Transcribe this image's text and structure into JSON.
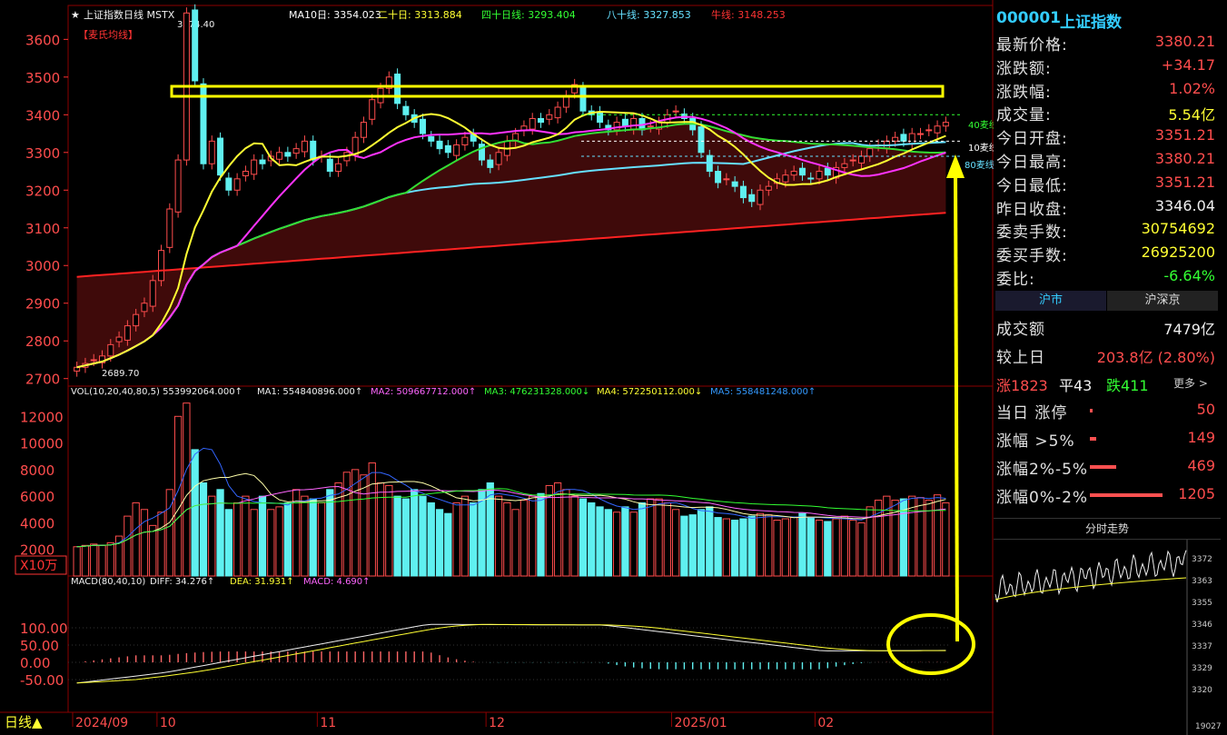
{
  "header": {
    "star": "★",
    "title": "上证指数日线 MSTX",
    "ma10": "MA10日: 3354.023",
    "ma20": "二十日: 3313.884",
    "ma40": "四十日线: 3293.404",
    "ma80": "八十线: 3327.853",
    "bull": "牛线: 3148.253",
    "tag": "【麦氏均线】",
    "high_label": "3674.40",
    "low_label": "2689.70"
  },
  "vol_header": {
    "title": "VOL(10,20,40,80,5) 553992064.000↑",
    "ma1": "MA1: 554840896.000↑",
    "ma2": "MA2: 509667712.000↑",
    "ma3": "MA3: 476231328.000↓",
    "ma4": "MA4: 572250112.000↓",
    "ma5": "MA5: 558481248.000↑",
    "unit": "X10万"
  },
  "macd_header": {
    "title": "MACD(80,40,10)",
    "diff": "DIFF: 34.276↑",
    "dea": "DEA: 31.931↑",
    "macd": "MACD: 4.690↑"
  },
  "line_labels": {
    "l40": "40麦线",
    "l10": "10麦线",
    "l80": "80麦线"
  },
  "bottom": {
    "period": "日线▲",
    "dates": [
      "2024/09",
      "10",
      "11",
      "12",
      "2025/01",
      "02"
    ]
  },
  "price_axis": [
    "3600",
    "3500",
    "3400",
    "3300",
    "3200",
    "3100",
    "3000",
    "2900",
    "2800",
    "2700"
  ],
  "vol_axis": [
    "12000",
    "10000",
    "8000",
    "6000",
    "4000",
    "2000"
  ],
  "macd_axis": [
    "100.00",
    "50.00",
    "0.00",
    "-50.00"
  ],
  "quote": {
    "code": "000001",
    "name": "上证指数",
    "rows": [
      {
        "label": "最新价格:",
        "value": "3380.21",
        "color": "red"
      },
      {
        "label": "涨跌额:",
        "value": "+34.17",
        "color": "red"
      },
      {
        "label": "涨跌幅:",
        "value": "1.02%",
        "color": "red"
      },
      {
        "label": "成交量:",
        "value": "5.54亿",
        "color": "yel"
      },
      {
        "label": "今日开盘:",
        "value": "3351.21",
        "color": "red"
      },
      {
        "label": "今日最高:",
        "value": "3380.21",
        "color": "red"
      },
      {
        "label": "今日最低:",
        "value": "3351.21",
        "color": "red"
      },
      {
        "label": "昨日收盘:",
        "value": "3346.04",
        "color": "wht"
      },
      {
        "label": "委卖手数:",
        "value": "30754692",
        "color": "yel"
      },
      {
        "label": "委买手数:",
        "value": "26925200",
        "color": "yel"
      },
      {
        "label": "委比:",
        "value": "-6.64%",
        "color": "grn"
      }
    ],
    "tabs": [
      "沪市",
      "沪深京"
    ],
    "turnover_label": "成交额",
    "turnover": "7479亿",
    "prev_label": "较上日",
    "prev": "203.8亿 (2.80%)",
    "up": "涨1823",
    "flat": "平43",
    "down": "跌411",
    "more": "更多 >",
    "stats": [
      {
        "label": "当日 涨停",
        "value": "50",
        "ratio": 0.03
      },
      {
        "label": "涨幅 >5%",
        "value": "149",
        "ratio": 0.09
      },
      {
        "label": "涨幅2%-5%",
        "value": "469",
        "ratio": 0.36
      },
      {
        "label": "涨幅0%-2%",
        "value": "1205",
        "ratio": 1.0
      }
    ],
    "mini_title": "分时走势",
    "mini_axis": [
      "3372",
      "3363",
      "3355",
      "3346",
      "3337",
      "3329",
      "3320"
    ],
    "mini_bottom": "19027"
  },
  "chart_data": {
    "type": "candlestick",
    "title": "上证指数日线",
    "x": [
      "2024/09",
      "10",
      "11",
      "12",
      "2025/01",
      "02"
    ],
    "ylim": [
      2680,
      3690
    ],
    "closes": [
      2730,
      2740,
      2750,
      2760,
      2790,
      2810,
      2840,
      2870,
      2900,
      2960,
      3040,
      3150,
      3280,
      3670,
      3490,
      3270,
      3330,
      3240,
      3200,
      3230,
      3250,
      3280,
      3270,
      3290,
      3300,
      3290,
      3310,
      3330,
      3280,
      3290,
      3250,
      3270,
      3300,
      3340,
      3380,
      3440,
      3470,
      3500,
      3430,
      3400,
      3380,
      3350,
      3330,
      3310,
      3300,
      3320,
      3340,
      3330,
      3280,
      3260,
      3300,
      3330,
      3350,
      3370,
      3390,
      3380,
      3400,
      3420,
      3450,
      3480,
      3410,
      3400,
      3380,
      3360,
      3380,
      3370,
      3390,
      3360,
      3370,
      3380,
      3400,
      3410,
      3390,
      3360,
      3300,
      3250,
      3220,
      3230,
      3210,
      3180,
      3170,
      3200,
      3210,
      3230,
      3240,
      3250,
      3240,
      3230,
      3250,
      3240,
      3260,
      3270,
      3280,
      3290,
      3310,
      3320,
      3330,
      3340,
      3330,
      3350,
      3350,
      3360,
      3370,
      3380
    ],
    "volume": [
      2200,
      2300,
      2400,
      2300,
      2500,
      3000,
      4500,
      5500,
      5000,
      3800,
      4800,
      6500,
      12000,
      13000,
      9500,
      7000,
      6000,
      6500,
      5000,
      5500,
      6000,
      5000,
      6000,
      5000,
      5200,
      5500,
      6500,
      6000,
      5800,
      5500,
      6500,
      7000,
      7800,
      8000,
      7600,
      8500,
      7000,
      6800,
      6000,
      5800,
      6500,
      6000,
      5500,
      5000,
      4700,
      5500,
      6000,
      5500,
      6500,
      7000,
      6000,
      5500,
      5000,
      5700,
      6000,
      6200,
      6800,
      7000,
      6500,
      6000,
      5800,
      5500,
      5200,
      5000,
      4800,
      5200,
      4800,
      5500,
      5800,
      5800,
      5500,
      5000,
      4500,
      4600,
      5000,
      5200,
      4400,
      4300,
      4200,
      4300,
      4500,
      4700,
      4600,
      4200,
      4300,
      4400,
      4700,
      4400,
      4200,
      4100,
      4300,
      4500,
      4200,
      4000,
      5200,
      5700,
      6000,
      5700,
      5800,
      6000,
      5900,
      5700,
      6100,
      5500
    ],
    "macd_note": "DIFF/DEA rise from -60 to 110 then decline to ~32"
  }
}
